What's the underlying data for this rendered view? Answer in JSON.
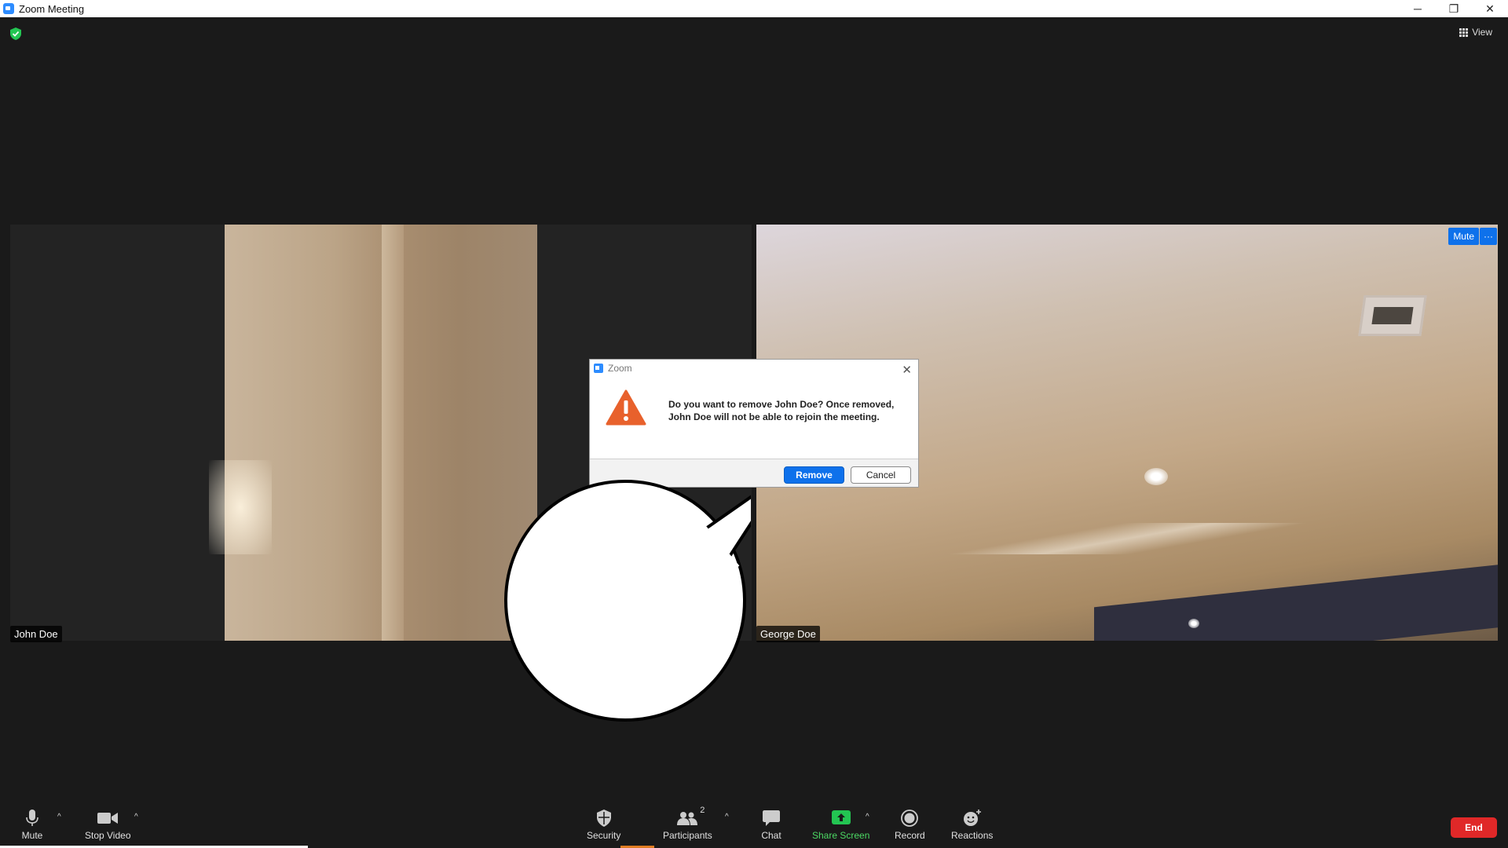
{
  "window": {
    "title": "Zoom Meeting",
    "controls": {
      "minimize": "─",
      "restore": "❐",
      "close": "✕"
    }
  },
  "topbar": {
    "view_label": "View"
  },
  "participants": {
    "left": {
      "name": "John Doe"
    },
    "right": {
      "name": "George Doe",
      "mute_label": "Mute",
      "more_label": "···"
    }
  },
  "dialog": {
    "title": "Zoom",
    "close": "✕",
    "message": "Do you want to remove John Doe? Once removed, John Doe will not be able to rejoin the meeting.",
    "remove_label": "Remove",
    "cancel_label": "Cancel"
  },
  "toolbar": {
    "mute": "Mute",
    "stop_video": "Stop Video",
    "security": "Security",
    "participants": "Participants",
    "participants_count": "2",
    "chat": "Chat",
    "share_screen": "Share Screen",
    "record": "Record",
    "reactions": "Reactions",
    "end": "End",
    "caret": "^"
  },
  "colors": {
    "accent_blue": "#0e71eb",
    "share_green": "#4cd964",
    "end_red": "#e02828",
    "warning_orange": "#e8612c"
  }
}
